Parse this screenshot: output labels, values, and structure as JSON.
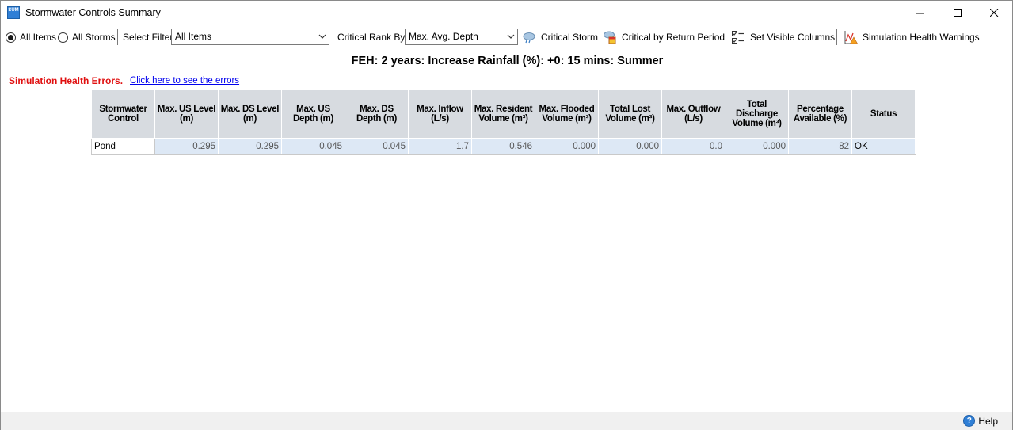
{
  "window": {
    "title": "Stormwater Controls Summary",
    "icon_text": "SUM"
  },
  "toolbar": {
    "all_items_label": "All Items",
    "all_storms_label": "All Storms",
    "selected_radio": "All Items",
    "select_filter_label": "Select Filter",
    "select_filter_value": "All Items",
    "critical_rank_label": "Critical Rank By:",
    "critical_rank_value": "Max. Avg. Depth",
    "critical_storm_label": "Critical Storm",
    "critical_return_label": "Critical by Return Period",
    "visible_columns_label": "Set Visible Columns",
    "health_warnings_label": "Simulation Health Warnings"
  },
  "heading": "FEH: 2 years: Increase Rainfall (%): +0: 15 mins: Summer",
  "errors": {
    "label": "Simulation Health Errors.",
    "link": "Click here to see the errors"
  },
  "table": {
    "columns": [
      "Stormwater Control",
      "Max. US Level (m)",
      "Max. DS Level (m)",
      "Max. US Depth (m)",
      "Max. DS Depth (m)",
      "Max. Inflow (L/s)",
      "Max. Resident Volume (m³)",
      "Max. Flooded Volume (m³)",
      "Total Lost Volume (m³)",
      "Max. Outflow (L/s)",
      "Total Discharge Volume (m³)",
      "Percentage Available (%)",
      "Status"
    ],
    "rows": [
      [
        "Pond",
        "0.295",
        "0.295",
        "0.045",
        "0.045",
        "1.7",
        "0.546",
        "0.000",
        "0.000",
        "0.0",
        "0.000",
        "82",
        "OK"
      ]
    ]
  },
  "statusbar": {
    "help_label": "Help"
  }
}
